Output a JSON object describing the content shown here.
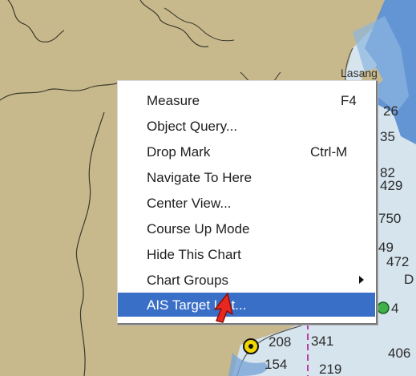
{
  "chart": {
    "place_label": "Lasang",
    "depth_numbers": [
      "26",
      "35",
      "82",
      "429",
      "750",
      "49",
      "472",
      "D",
      "4",
      "208",
      "341",
      "154",
      "406",
      "219"
    ]
  },
  "menu": {
    "items": [
      {
        "label": "Measure",
        "shortcut": "F4"
      },
      {
        "label": "Object Query..."
      },
      {
        "label": "Drop Mark",
        "shortcut": "Ctrl-M"
      },
      {
        "label": "Navigate To Here"
      },
      {
        "label": "Center View..."
      },
      {
        "label": "Course Up Mode"
      },
      {
        "label": "Hide This Chart"
      },
      {
        "label": "Chart Groups",
        "has_submenu": true
      },
      {
        "label": "AIS Target List...",
        "highlighted": true
      }
    ]
  },
  "colors": {
    "land": "#c8b98d",
    "water_light": "#cfe0ee",
    "water_deep": "#4f86cf",
    "menu_highlight": "#3a6fc8",
    "cursor": "#e8281e"
  }
}
